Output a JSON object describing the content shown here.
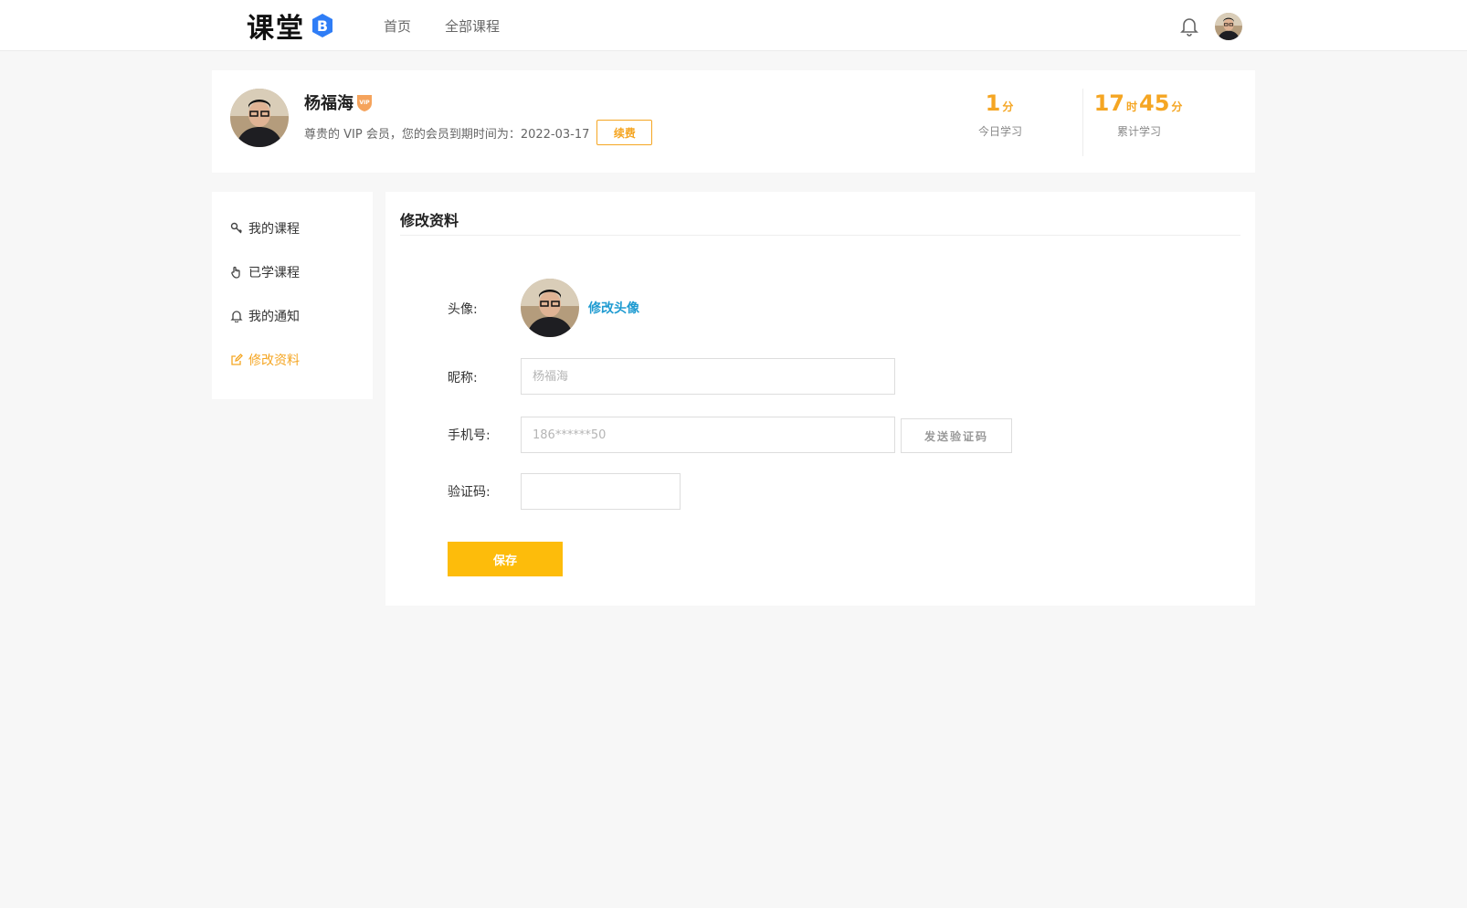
{
  "header": {
    "logo_text": "课堂",
    "logo_badge": "B",
    "nav": [
      "首页",
      "全部课程"
    ]
  },
  "profile": {
    "name": "杨福海",
    "vip_label": "VIP",
    "subtitle": "尊贵的 VIP 会员，您的会员到期时间为：2022-03-17",
    "renew_label": "续费",
    "today": {
      "value": "1",
      "unit": "分",
      "label": "今日学习"
    },
    "total": {
      "hours": "17",
      "hours_unit": "时",
      "minutes": "45",
      "minutes_unit": "分",
      "label": "累计学习"
    }
  },
  "sidebar": {
    "items": [
      {
        "label": "我的课程",
        "icon": "key-icon"
      },
      {
        "label": "已学课程",
        "icon": "hand-icon"
      },
      {
        "label": "我的通知",
        "icon": "bell-icon"
      },
      {
        "label": "修改资料",
        "icon": "edit-icon",
        "active": true
      }
    ]
  },
  "form": {
    "title": "修改资料",
    "avatar_label": "头像:",
    "change_avatar": "修改头像",
    "nickname_label": "昵称:",
    "nickname_placeholder": "杨福海",
    "phone_label": "手机号:",
    "phone_placeholder": "186******50",
    "send_code_label": "发送验证码",
    "code_label": "验证码:",
    "save_label": "保存"
  },
  "colors": {
    "accent": "#f5a623",
    "save": "#fdbc0b",
    "link": "#1f9bd1"
  }
}
